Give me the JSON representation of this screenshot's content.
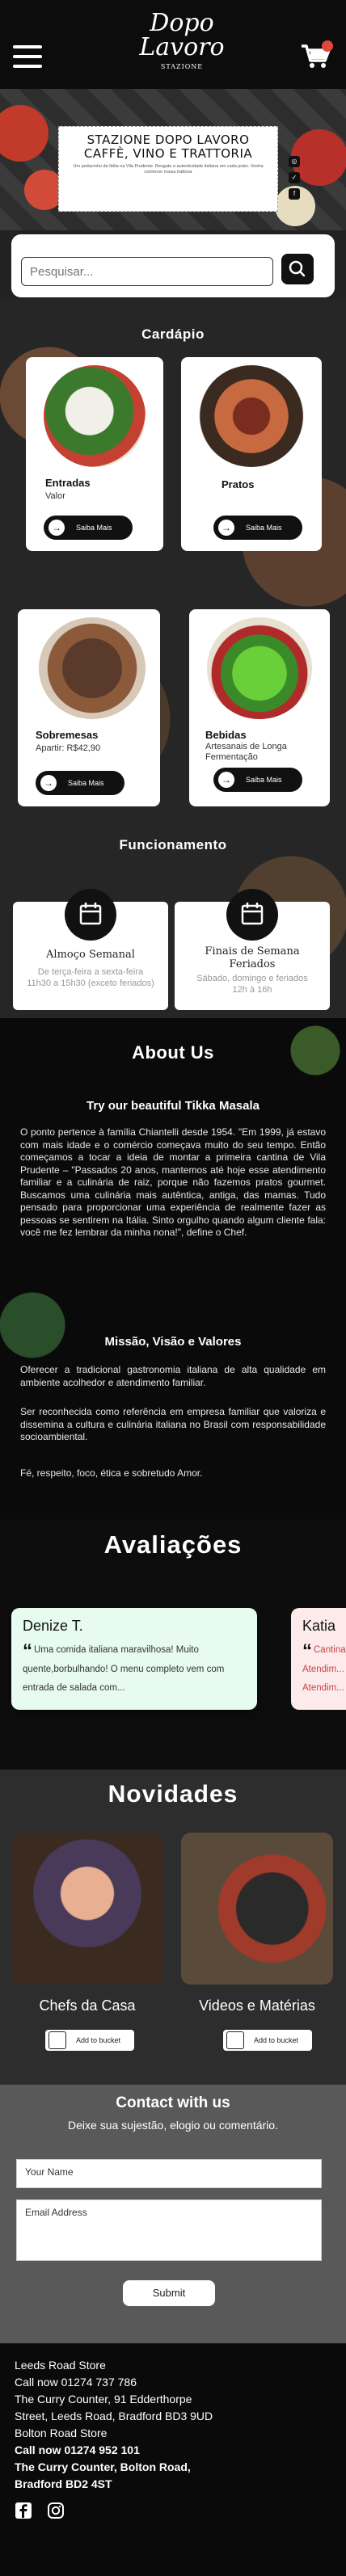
{
  "header": {
    "logo_line1": "Dopo",
    "logo_line2": "Lavoro",
    "logo_line3": "STAZIONE",
    "menu_icon": "hamburger-icon",
    "cart_icon": "cart-icon"
  },
  "hero": {
    "title": "STAZIONE DOPO LAVORO CAFFÈ, VINO E TRATTORIA",
    "subtitle": "Um pedacinho da Itália na Vila Prudente. Resgate a autenticidade italiana em cada prato. Venha conhecer nossa trattoria",
    "social_icons": [
      "instagram-icon",
      "twitter-icon",
      "facebook-icon"
    ]
  },
  "search": {
    "placeholder": "Pesquisar...",
    "button_icon": "search-icon"
  },
  "menu": {
    "title": "Cardápio",
    "button_label": "Saiba Mais",
    "items": [
      {
        "name": "Entradas",
        "desc": "Valor"
      },
      {
        "name": "Pratos",
        "desc": ""
      },
      {
        "name": "Sobremesas",
        "desc": "Apartir: R$42,90"
      },
      {
        "name": "Bebidas",
        "desc": "Artesanais de Longa Fermentação"
      }
    ]
  },
  "hours": {
    "title": "Funcionamento",
    "cards": [
      {
        "title": "Almoço Semanal",
        "text": "De terça-feira a sexta-feira 11h30 a 15h30 (exceto feriados)"
      },
      {
        "title": "Finais de Semana Feriados",
        "text": "Sábado, domingo e feriados 12h à 16h"
      }
    ]
  },
  "about": {
    "title": "About Us",
    "subtitle": "Try our beautiful Tikka Masala",
    "text": "O ponto pertence à família Chiantelli desde 1954. \"Em 1999, já estavo com mais idade e o comércio começava muito do seu tempo. Então começamos a tocar a ideia de montar a primeira cantina de Vila Prudente – \"Passados 20 anos, mantemos até hoje esse atendimento familiar e a culinária de raiz, porque não fazemos pratos gourmet. Buscamos uma culinária mais autêntica, antiga, das mamas. Tudo pensado para proporcionar uma experiência de realmente fazer as pessoas se sentirem na Itália. Sinto orgulho quando algum cliente fala: você me fez lembrar da minha nona!\", define o Chef.",
    "mission_title": "Missão, Visão e Valores",
    "mission": "Oferecer a tradicional gastronomia italiana de alta qualidade em ambiente acolhedor e atendimento familiar.",
    "vision": "Ser reconhecida como referência em empresa familiar que valoriza e dissemina a cultura e culinária italiana no Brasil com responsabilidade socioambiental.",
    "values": "Fé, respeito, foco, ética e sobretudo Amor."
  },
  "reviews": {
    "title": "Avaliações",
    "items": [
      {
        "name": "Denize T.",
        "text": "Uma comida italiana maravilhosa! Muito quente,borbulhando! O menu completo vem com entrada de salada com..."
      },
      {
        "name": "Katia",
        "text": "Cantina... Atendim... Atendim..."
      }
    ]
  },
  "news": {
    "title": "Novidades",
    "items": [
      {
        "caption": "Chefs da Casa",
        "bucket": "Add to bucket"
      },
      {
        "caption": "Videos e Matérias",
        "bucket": "Add to bucket"
      }
    ]
  },
  "contact": {
    "title": "Contact with us",
    "subtitle": "Deixe sua sujestão, elogio ou comentário.",
    "name_placeholder": "Your Name",
    "email_placeholder": "Email Address",
    "submit": "Submit"
  },
  "footer": {
    "lines": [
      "Leeds Road Store",
      "Call now 01274 737 786",
      "The Curry Counter, 91 Edderthorpe",
      "Street, Leeds Road, Bradford BD3 9UD",
      "Bolton Road Store"
    ],
    "bold_lines": [
      "Call now 01274 952 101",
      "The Curry Counter, Bolton Road,",
      "Bradford BD2 4ST"
    ],
    "social": [
      "facebook-icon",
      "instagram-icon"
    ]
  }
}
